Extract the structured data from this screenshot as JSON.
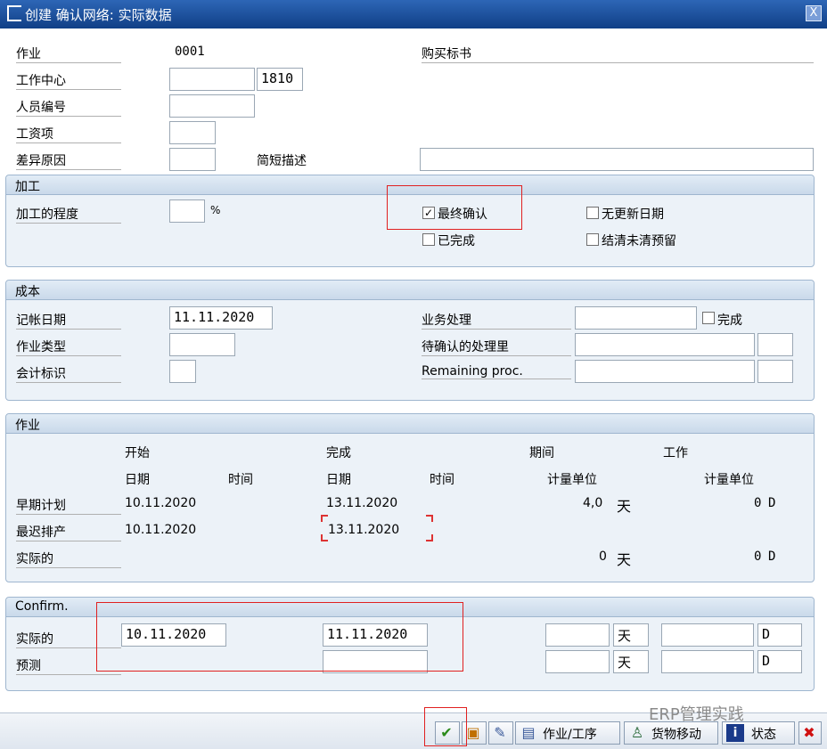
{
  "window": {
    "title": "创建 确认网络: 实际数据",
    "close": "X"
  },
  "header": {
    "activity_label": "作业",
    "activity_value": "0001",
    "purchase_label": "购买标书",
    "work_center_label": "工作中心",
    "work_center_value": "",
    "plant_value": "1810",
    "personnel_label": "人员编号",
    "wage_label": "工资项",
    "variance_label": "差异原因",
    "short_text_label": "简短描述"
  },
  "processing": {
    "title": "加工",
    "degree_label": "加工的程度",
    "percent": "%",
    "final_conf": "最终确认",
    "final_conf_checked": true,
    "no_date_update": "无更新日期",
    "completed": "已完成",
    "clear_reservations": "结清未清预留"
  },
  "cost": {
    "title": "成本",
    "posting_date_label": "记帐日期",
    "posting_date": "11.11.2020",
    "activity_type_label": "作业类型",
    "accounting_label": "会计标识",
    "business_label": "业务处理",
    "complete_label": "完成",
    "pending_label": "待确认的处理里",
    "remaining_label": "Remaining proc."
  },
  "activity": {
    "title": "作业",
    "start": "开始",
    "finish": "完成",
    "duration": "期间",
    "work": "工作",
    "date": "日期",
    "time": "时间",
    "unit": "计量单位",
    "rows": [
      {
        "label": "早期计划",
        "start": "10.11.2020",
        "finish": "13.11.2020",
        "dur": "4,0",
        "dur_unit": "天",
        "work": "0",
        "work_unit": "D"
      },
      {
        "label": "最迟排产",
        "start": "10.11.2020",
        "finish": "13.11.2020"
      },
      {
        "label": "实际的",
        "dur": "0",
        "dur_unit": "天",
        "work": "0",
        "work_unit": "D"
      }
    ]
  },
  "confirm": {
    "title": "Confirm.",
    "actual_label": "实际的",
    "forecast_label": "预测",
    "actual_start": "10.11.2020",
    "actual_finish": "11.11.2020",
    "day_unit": "天",
    "work_unit": "D"
  },
  "toolbar": {
    "activity_btn": "作业/工序",
    "goods_btn": "货物移动",
    "status_btn": "状态"
  },
  "watermark": "ERP管理实践"
}
